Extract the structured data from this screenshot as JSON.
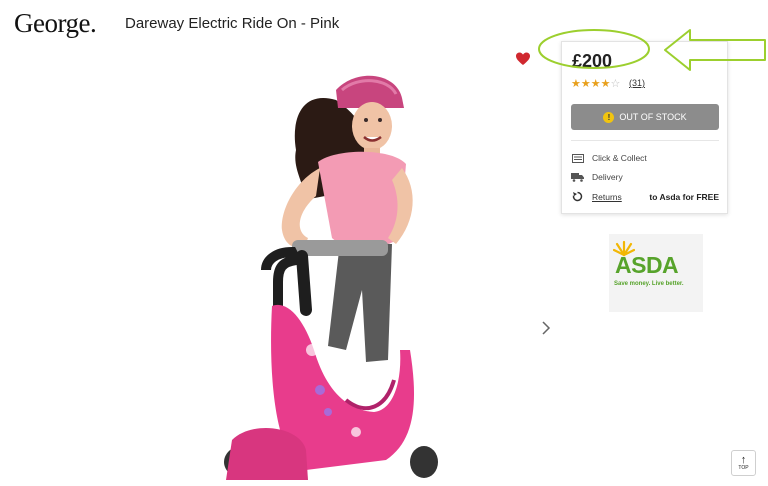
{
  "header": {
    "logo": "George.",
    "product_title": "Dareway Electric Ride On - Pink"
  },
  "gallery": {
    "image_semantic": "girl-riding-pink-electric-scooter-image",
    "next_icon": "chevron-right-icon"
  },
  "favourite": {
    "icon": "heart-icon",
    "color": "#d0282f"
  },
  "purchase_panel": {
    "price": "£200",
    "rating_stars": 4,
    "rating_max": 5,
    "review_count": "(31)",
    "stock_button_label": "OUT OF STOCK",
    "stock_icon": "warning-icon",
    "options": {
      "click_collect": "Click & Collect",
      "delivery": "Delivery",
      "returns": "Returns",
      "returns_note": "to Asda for FREE"
    }
  },
  "asda_badge": {
    "wordmark": "ASDA",
    "tagline": "Save money. Live better.",
    "color": "#57a32b"
  },
  "annotation": {
    "color": "#9ccf2e"
  },
  "scroll_top": {
    "label": "TOP",
    "icon": "arrow-up-icon"
  }
}
